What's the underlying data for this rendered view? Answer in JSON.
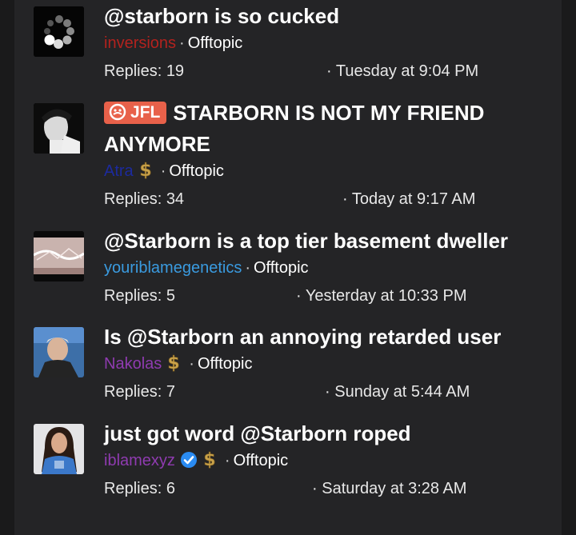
{
  "threads": [
    {
      "title": "@starborn is so cucked",
      "author": "inversions",
      "forum": "Offtopic",
      "replies": "Replies: 19",
      "date": "Tuesday at 9:04 PM"
    },
    {
      "prefix": "JFL",
      "title": "STARBORN IS NOT MY FRIEND ANYMORE",
      "author": "Atra",
      "forum": "Offtopic",
      "replies": "Replies: 34",
      "date": "Today at 9:17 AM"
    },
    {
      "title": "@Starborn is a top tier basement dweller",
      "author": "youriblamegenetics",
      "forum": "Offtopic",
      "replies": "Replies: 5",
      "date": "Yesterday at 10:33 PM"
    },
    {
      "title": "Is @Starborn an annoying retarded user",
      "author": "Nakolas",
      "forum": "Offtopic",
      "replies": "Replies: 7",
      "date": "Sunday at 5:44 AM"
    },
    {
      "title": "just got word @Starborn roped",
      "author": "iblamexyz",
      "forum": "Offtopic",
      "replies": "Replies: 6",
      "date": "Saturday at 3:28 AM"
    }
  ],
  "colors": {
    "background": "#242426",
    "prefix_tag": "#e8614a",
    "verified": "#2a8bf2",
    "dollar": "#c9a24a"
  },
  "icons": [
    "spinner-avatar-icon",
    "dollar-badge-icon",
    "verified-badge-icon",
    "jfl-prefix-icon"
  ],
  "separator": "·"
}
